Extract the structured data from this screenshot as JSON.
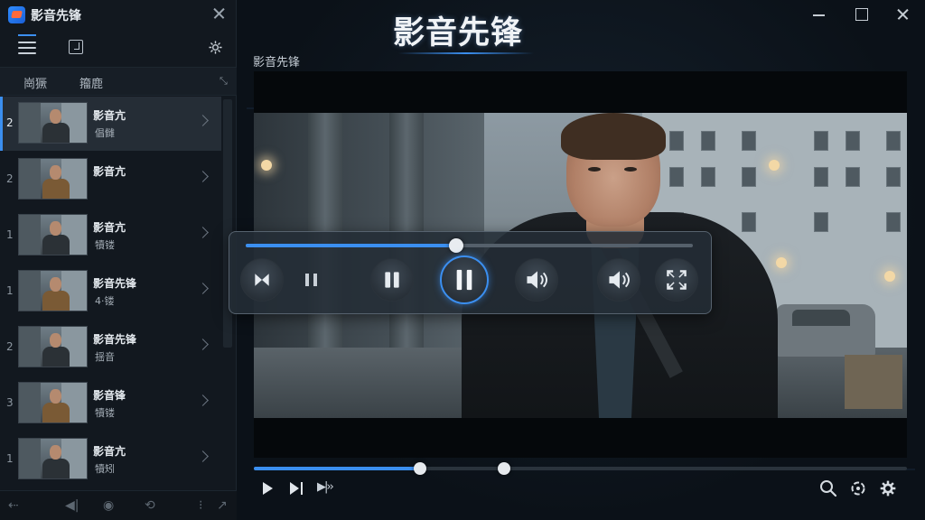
{
  "app": {
    "window_title": "影音先锋 ",
    "brand_title": "影音先锋",
    "video_label": "影音先锋"
  },
  "sidebar": {
    "tabs": [
      {
        "label": "崗獗"
      },
      {
        "label": "籀鹿"
      }
    ],
    "items": [
      {
        "number": "2",
        "title": "影音亢",
        "subtitle": "倡雠",
        "active": true
      },
      {
        "number": "2",
        "title": "影音亢",
        "subtitle": "",
        "active": false
      },
      {
        "number": "1",
        "title": "影音亢",
        "subtitle": "犢镂",
        "active": false
      },
      {
        "number": "1",
        "title": "影音先锋",
        "subtitle": "4·镂",
        "active": false
      },
      {
        "number": "2",
        "title": "影音先锋",
        "subtitle": "揺音",
        "active": false
      },
      {
        "number": "3",
        "title": "影音锋",
        "subtitle": "犢镂",
        "active": false
      },
      {
        "number": "1",
        "title": "影音亢",
        "subtitle": "犢矧",
        "active": false
      }
    ]
  },
  "player": {
    "floating_progress": 0.47,
    "bottom_progress": 0.255,
    "bottom_secondary_marker": 0.383,
    "speed_icon": "▶|››"
  },
  "icons": {
    "sidebar_toolbar": [
      "menu-icon",
      "pin-icon",
      "gear-icon"
    ],
    "floating_controls": [
      "skip-icon",
      "pause-icon",
      "pause-icon",
      "pause-icon",
      "volume-icon",
      "volume-icon",
      "fullscreen-icon"
    ],
    "bottom_left": [
      "play-icon",
      "next-icon",
      "speed-icon"
    ],
    "bottom_right": [
      "search-icon",
      "loop-icon",
      "gear-icon"
    ],
    "sidebar_bottom": [
      "back-icon",
      "volume-icon",
      "disc-icon",
      "rotate-icon",
      "forward-icon"
    ]
  },
  "colors": {
    "accent": "#3b8ff0",
    "background": "#0b1118",
    "sidebar": "#12181f"
  }
}
